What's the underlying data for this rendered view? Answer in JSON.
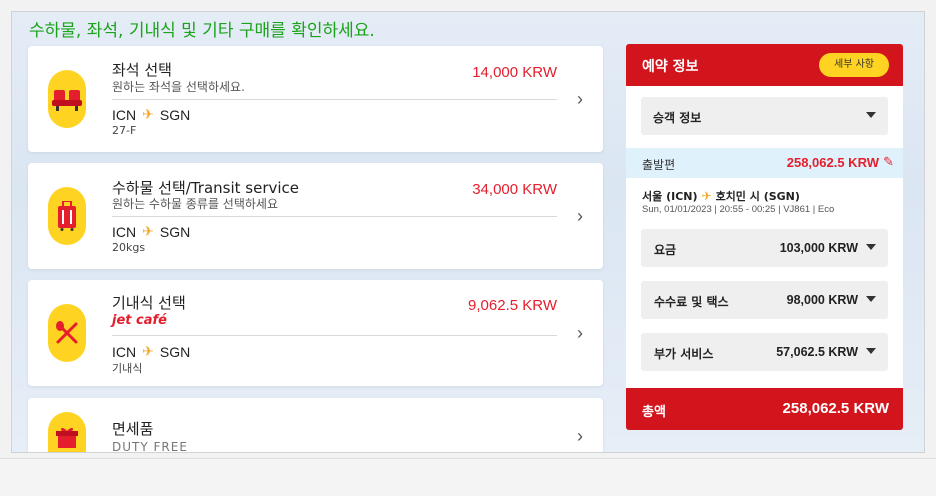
{
  "headline": "수하물, 좌석, 기내식 및 기타 구매를 확인하세요.",
  "cards": [
    {
      "title": "좌석 선택",
      "sub": "원하는 좌석을 선택하세요.",
      "price": "14,000 KRW",
      "origin": "ICN",
      "dest": "SGN",
      "detail": "27-F",
      "icon": "seat-icon"
    },
    {
      "title": "수하물 선택/Transit service",
      "sub": "원하는 수하물 종류를 선택하세요",
      "price": "34,000 KRW",
      "origin": "ICN",
      "dest": "SGN",
      "detail": "20kgs",
      "icon": "luggage-icon"
    },
    {
      "title": "기내식 선택",
      "sub": "jet café",
      "price": "9,062.5 KRW",
      "origin": "ICN",
      "dest": "SGN",
      "detail": "기내식",
      "icon": "meal-icon"
    },
    {
      "title": "면세품",
      "sub": "DUTY FREE",
      "icon": "gift-icon"
    }
  ],
  "panel": {
    "title": "예약 정보",
    "detail_button": "세부 사항",
    "passenger_label": "승객 정보",
    "outbound_label": "출발편",
    "outbound_amount": "258,062.5 KRW",
    "route_from": "서울 (ICN)",
    "route_to": "호치민 시 (SGN)",
    "flight_info": "Sun, 01/01/2023 | 20:55 - 00:25 | VJ861 | Eco",
    "fees": [
      {
        "label": "요금",
        "amount": "103,000 KRW"
      },
      {
        "label": "수수료 및 택스",
        "amount": "98,000 KRW"
      },
      {
        "label": "부가 서비스",
        "amount": "57,062.5 KRW"
      }
    ],
    "total_label": "총액",
    "total_amount": "258,062.5 KRW"
  },
  "colors": {
    "accent_red": "#d2141c",
    "accent_yellow": "#ffd321",
    "headline_green": "#1aa31a"
  }
}
